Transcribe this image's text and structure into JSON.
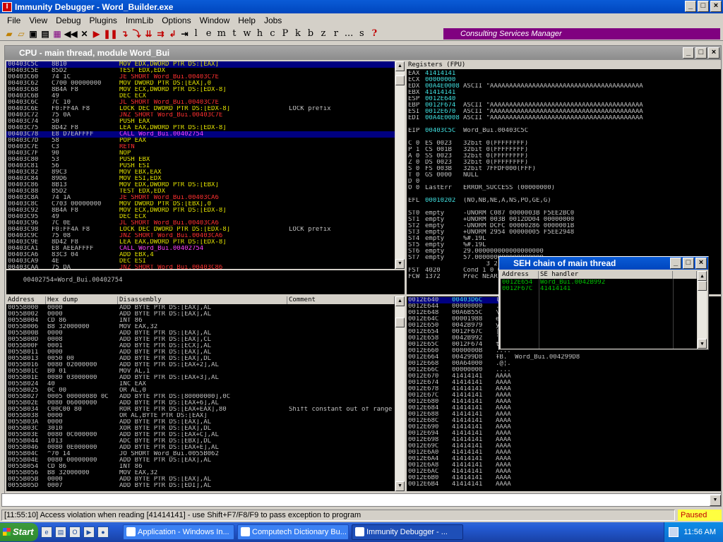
{
  "window": {
    "title": "Immunity Debugger - Word_Builder.exe",
    "min": "_",
    "max": "□",
    "close": "×"
  },
  "menu": [
    "File",
    "View",
    "Debug",
    "Plugins",
    "ImmLib",
    "Options",
    "Window",
    "Help",
    "Jobs"
  ],
  "toolbar": {
    "letters": [
      "l",
      "e",
      "m",
      "t",
      "w",
      "h",
      "c",
      "P",
      "k",
      "b",
      "z",
      "r",
      "...",
      "s",
      "?"
    ],
    "banner": "Consulting Services Manager"
  },
  "cpu": {
    "title": "CPU - main thread, module Word_Bui",
    "info_line": "00402754=Word_Bui.00402754"
  },
  "disasm": [
    [
      "00403C5C",
      "8B10",
      "MOV EDX,DWORD PTR DS:[EAX]",
      "",
      "g"
    ],
    [
      "00403C5E",
      "85D2",
      "TEST EDX,EDX",
      "",
      "g"
    ],
    [
      "00403C60",
      "74 1C",
      "JE SHORT Word_Bui.00403C7E",
      "",
      "r"
    ],
    [
      "00403C62",
      "C700 00000000",
      "MOV DWORD PTR DS:[EAX],0",
      "",
      "g"
    ],
    [
      "00403C68",
      "8B4A F8",
      "MOV ECX,DWORD PTR DS:[EDX-8]",
      "",
      "g"
    ],
    [
      "00403C6B",
      "49",
      "DEC ECX",
      "",
      "g"
    ],
    [
      "00403C6C",
      "7C 10",
      "JL SHORT Word_Bui.00403C7E",
      "",
      "r"
    ],
    [
      "00403C6E",
      "F0:FF4A F8",
      "LOCK DEC DWORD PTR DS:[EDX-8]",
      "LOCK prefix",
      "g"
    ],
    [
      "00403C72",
      "75 0A",
      "JNZ SHORT Word_Bui.00403C7E",
      "",
      "r"
    ],
    [
      "00403C74",
      "50",
      "PUSH EAX",
      "",
      "g"
    ],
    [
      "00403C75",
      "8D42 F8",
      "LEA EAX,DWORD PTR DS:[EDX-8]",
      "",
      "g"
    ],
    [
      "00403C78",
      "E8 D7EAFFFF",
      "CALL Word_Bui.00402754",
      "",
      "m"
    ],
    [
      "00403C7D",
      "58",
      "POP EAX",
      "",
      "g"
    ],
    [
      "00403C7E",
      "C3",
      "RETN",
      "",
      "r"
    ],
    [
      "00403C7F",
      "90",
      "NOP",
      "",
      "g"
    ],
    [
      "00403C80",
      "53",
      "PUSH EBX",
      "",
      "g"
    ],
    [
      "00403C81",
      "56",
      "PUSH ESI",
      "",
      "g"
    ],
    [
      "00403C82",
      "89C3",
      "MOV EBX,EAX",
      "",
      "g"
    ],
    [
      "00403C84",
      "89D6",
      "MOV ESI,EDX",
      "",
      "g"
    ],
    [
      "00403C86",
      "8B13",
      "MOV EDX,DWORD PTR DS:[EBX]",
      "",
      "g"
    ],
    [
      "00403C88",
      "85D2",
      "TEST EDX,EDX",
      "",
      "g"
    ],
    [
      "00403C8A",
      "74 1A",
      "JE SHORT Word_Bui.00403CA6",
      "",
      "r"
    ],
    [
      "00403C8C",
      "C703 00000000",
      "MOV DWORD PTR DS:[EBX],0",
      "",
      "g"
    ],
    [
      "00403C92",
      "8B4A F8",
      "MOV ECX,DWORD PTR DS:[EDX-8]",
      "",
      "g"
    ],
    [
      "00403C95",
      "49",
      "DEC ECX",
      "",
      "g"
    ],
    [
      "00403C96",
      "7C 0E",
      "JL SHORT Word_Bui.00403CA6",
      "",
      "r"
    ],
    [
      "00403C98",
      "F0:FF4A F8",
      "LOCK DEC DWORD PTR DS:[EDX-8]",
      "LOCK prefix",
      "g"
    ],
    [
      "00403C9C",
      "75 08",
      "JNZ SHORT Word_Bui.00403CA6",
      "",
      "r"
    ],
    [
      "00403C9E",
      "8D42 F8",
      "LEA EAX,DWORD PTR DS:[EDX-8]",
      "",
      "g"
    ],
    [
      "00403CA1",
      "E8 AEEAFFFF",
      "CALL Word_Bui.00402754",
      "",
      "m"
    ],
    [
      "00403CA6",
      "83C3 04",
      "ADD EBX,4",
      "",
      "g"
    ],
    [
      "00403CA9",
      "4E",
      "DEC ESI",
      "",
      "g"
    ],
    [
      "00403CAA",
      "75 DA",
      "JNZ SHORT Word_Bui.00403C86",
      "",
      "r"
    ]
  ],
  "registers": {
    "header": "Registers (FPU)",
    "lines": [
      [
        "EAX",
        "41414141",
        ""
      ],
      [
        "ECX",
        "00000000",
        ""
      ],
      [
        "EDX",
        "00A4E0008",
        "ASCII \"AAAAAAAAAAAAAAAAAAAAAAAAAAAAAAAAAAAAAAAA"
      ],
      [
        "EBX",
        "41414141",
        ""
      ],
      [
        "ESP",
        "0012E640",
        ""
      ],
      [
        "EBP",
        "0012F674",
        "ASCII \"AAAAAAAAAAAAAAAAAAAAAAAAAAAAAAAAAAAAAAAA"
      ],
      [
        "ESI",
        "0012E670",
        "ASCII \"AAAAAAAAAAAAAAAAAAAAAAAAAAAAAAAAAAAAAAAA"
      ],
      [
        "EDI",
        "00A4E0008",
        "ASCII \"AAAAAAAAAAAAAAAAAAAAAAAAAAAAAAAAAAAAAAAA"
      ],
      [
        "",
        "",
        " "
      ],
      [
        "EIP",
        "00403C5C",
        "Word_Bui.00403C5C"
      ],
      [
        "",
        "",
        " "
      ],
      [
        "C 0",
        "ES 0023",
        "32bit 0(FFFFFFFF)"
      ],
      [
        "P 1",
        "CS 001B",
        "32bit 0(FFFFFFFF)"
      ],
      [
        "A 0",
        "SS 0023",
        "32bit 0(FFFFFFFF)"
      ],
      [
        "Z 0",
        "DS 0023",
        "32bit 0(FFFFFFFF)"
      ],
      [
        "S 0",
        "FS 003B",
        "32bit 7FFDF000(FFF)"
      ],
      [
        "T 0",
        "GS 0000",
        "NULL"
      ],
      [
        "D 0",
        "",
        ""
      ],
      [
        "O 0",
        "LastErr",
        "ERROR_SUCCESS (00000000)"
      ],
      [
        "",
        "",
        " "
      ],
      [
        "EFL",
        "00010202",
        "(NO,NB,NE,A,NS,PO,GE,G)"
      ],
      [
        "",
        "",
        " "
      ],
      [
        "ST0",
        "empty",
        "-UNORM C087 0000003B F5EE2BC0"
      ],
      [
        "ST1",
        "empty",
        "+UNORM 003B 0012DD04 00000000"
      ],
      [
        "ST2",
        "empty",
        "-UNORM DCFC 00000286 0000001B"
      ],
      [
        "ST3",
        "empty",
        "+UNORM 2954 00000005 F5EE2948"
      ],
      [
        "ST4",
        "empty",
        "%#.19L"
      ],
      [
        "ST5",
        "empty",
        "%#.19L"
      ],
      [
        "ST6",
        "empty",
        "29.000000000000000000"
      ],
      [
        "ST7",
        "empty",
        "57.000000000000000000"
      ],
      [
        "",
        "",
        "      3 2 1 0       E S P U O Z D I"
      ],
      [
        "FST",
        "4020",
        "Cond 1 0 0 0  Err 0 0 1 0 0 0 0 0"
      ],
      [
        "FCW",
        "1372",
        "Prec NEAR,64  Mask 1 1 0 0 1 0"
      ]
    ]
  },
  "dump": {
    "headers": [
      "Address",
      "Hex dump",
      "Disassembly",
      "Comment"
    ],
    "rows": [
      [
        "0055B000",
        "0000",
        "ADD BYTE PTR DS:[EAX],AL",
        ""
      ],
      [
        "0055B002",
        "0000",
        "ADD BYTE PTR DS:[EAX],AL",
        ""
      ],
      [
        "0055B004",
        "CD 86",
        "INT 86",
        ""
      ],
      [
        "0055B006",
        "B8 32000000",
        "MOV EAX,32",
        ""
      ],
      [
        "0055B00B",
        "0000",
        "ADD BYTE PTR DS:[EAX],AL",
        ""
      ],
      [
        "0055B00D",
        "0008",
        "ADD BYTE PTR DS:[EAX],CL",
        ""
      ],
      [
        "0055B00F",
        "0001",
        "ADD BYTE PTR DS:[ECX],AL",
        ""
      ],
      [
        "0055B011",
        "0000",
        "ADD BYTE PTR DS:[EAX],AL",
        ""
      ],
      [
        "0055B013",
        "0050 00",
        "ADD BYTE PTR DS:[EAX],DL",
        ""
      ],
      [
        "0055B016",
        "0080 02000000",
        "ADD BYTE PTR DS:[EAX+2],AL",
        ""
      ],
      [
        "0055B01C",
        "B0 01",
        "MOV AL,1",
        ""
      ],
      [
        "0055B01E",
        "0080 03000000",
        "ADD BYTE PTR DS:[EAX+3],AL",
        ""
      ],
      [
        "0055B024",
        "40",
        "INC EAX",
        ""
      ],
      [
        "0055B025",
        "0C 00",
        "OR AL,0",
        ""
      ],
      [
        "0055B027",
        "0005 00000080 0C",
        "ADD BYTE PTR DS:[80000000],0C",
        ""
      ],
      [
        "0055B02E",
        "0080 06000000",
        "ADD BYTE PTR DS:[EAX+6],AL",
        ""
      ],
      [
        "0055B034",
        "C00C00 80",
        "ROR BYTE PTR DS:[EAX+EAX],80",
        "Shift constant out of range"
      ],
      [
        "0055B038",
        "0000",
        "OR AL,BYTE PTR DS:[EAX]",
        ""
      ],
      [
        "0055B03A",
        "0000",
        "ADD BYTE PTR DS:[EAX],AL",
        ""
      ],
      [
        "0055B03C",
        "3010",
        "XOR BYTE PTR DS:[EAX],DL",
        ""
      ],
      [
        "0055B03E",
        "0080 0C000000",
        "ADD BYTE PTR DS:[EAX+C],AL",
        ""
      ],
      [
        "0055B044",
        "1013",
        "ADC BYTE PTR DS:[EBX],DL",
        ""
      ],
      [
        "0055B046",
        "0080 0E000000",
        "ADD BYTE PTR DS:[EAX+E],AL",
        ""
      ],
      [
        "0055B04C",
        "^70 14",
        "JO SHORT Word_Bui.0055B062",
        ""
      ],
      [
        "0055B04E",
        "0080 00000000",
        "ADD BYTE PTR DS:[EAX],AL",
        ""
      ],
      [
        "0055B054",
        "CD 86",
        "INT 86",
        ""
      ],
      [
        "0055B056",
        "B8 32000000",
        "MOV EAX,32",
        ""
      ],
      [
        "0055B05B",
        "0000",
        "ADD BYTE PTR DS:[EAX],AL",
        ""
      ],
      [
        "0055B05D",
        "0007",
        "ADD BYTE PTR DS:[EDI],AL",
        ""
      ]
    ]
  },
  "stack": [
    [
      "0012E640",
      "00403D6C",
      "l=@."
    ],
    [
      "0012E644",
      "00000000",
      "...."
    ],
    [
      "0012E648",
      "00A6B55C",
      "\\U.."
    ],
    [
      "0012E64C",
      "00001988",
      "ë..."
    ],
    [
      "0012E650",
      "0042B979",
      "yB."
    ],
    [
      "0012E654",
      "0012F67C",
      "|ö.."
    ],
    [
      "0012E658",
      "0042B992",
      "'B."
    ],
    [
      "0012E65C",
      "0012F674",
      "tö.."
    ],
    [
      "0012E660",
      "0000000B",
      "...."
    ],
    [
      "0012E664",
      "004299D8",
      "ŦB.  Word_Bui.004299D8"
    ],
    [
      "0012E668",
      "00A64000",
      ".@¦."
    ],
    [
      "0012E66C",
      "00000000",
      "...."
    ],
    [
      "0012E670",
      "41414141",
      "AAAA"
    ],
    [
      "0012E674",
      "41414141",
      "AAAA"
    ],
    [
      "0012E678",
      "41414141",
      "AAAA"
    ],
    [
      "0012E67C",
      "41414141",
      "AAAA"
    ],
    [
      "0012E680",
      "41414141",
      "AAAA"
    ],
    [
      "0012E684",
      "41414141",
      "AAAA"
    ],
    [
      "0012E688",
      "41414141",
      "AAAA"
    ],
    [
      "0012E68C",
      "41414141",
      "AAAA"
    ],
    [
      "0012E690",
      "41414141",
      "AAAA"
    ],
    [
      "0012E694",
      "41414141",
      "AAAA"
    ],
    [
      "0012E698",
      "41414141",
      "AAAA"
    ],
    [
      "0012E69C",
      "41414141",
      "AAAA"
    ],
    [
      "0012E6A0",
      "41414141",
      "AAAA"
    ],
    [
      "0012E6A4",
      "41414141",
      "AAAA"
    ],
    [
      "0012E6A8",
      "41414141",
      "AAAA"
    ],
    [
      "0012E6AC",
      "41414141",
      "AAAA"
    ],
    [
      "0012E6B0",
      "41414141",
      "AAAA"
    ],
    [
      "0012E6B4",
      "41414141",
      "AAAA"
    ]
  ],
  "seh": {
    "title": "SEH chain of main thread",
    "headers": [
      "Address",
      "SE handler"
    ],
    "rows": [
      [
        "0012E654",
        "Word_Bui.0042B992"
      ],
      [
        "0012F67C",
        "41414141"
      ]
    ]
  },
  "status": {
    "message": "[11:55:10] Access violation when reading [41414141] - use Shift+F7/F8/F9 to pass exception to program",
    "state": "Paused"
  },
  "taskbar": {
    "start": "Start",
    "tasks": [
      "Application - Windows In...",
      "Computech Dictionary Bu...",
      "Immunity Debugger - ..."
    ],
    "clock": "11:56 AM"
  },
  "colors": {
    "accent": "#0a5bd6",
    "selection": "#000080",
    "banner": "#800080",
    "paused": "#ffff40"
  }
}
